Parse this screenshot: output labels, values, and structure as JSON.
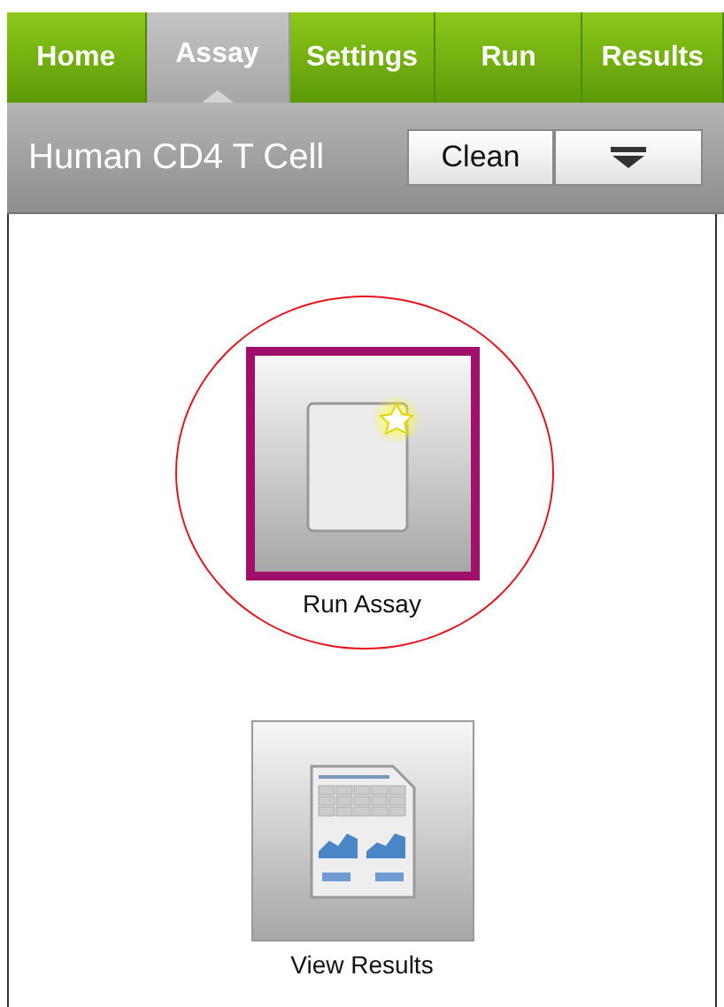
{
  "tabs": [
    {
      "label": "Home",
      "selected": false
    },
    {
      "label": "Assay",
      "selected": true
    },
    {
      "label": "Settings",
      "selected": false
    },
    {
      "label": "Run",
      "selected": false
    },
    {
      "label": "Results",
      "selected": false
    }
  ],
  "header": {
    "title": "Human CD4 T Cell",
    "buttons": [
      {
        "kind": "text",
        "label": "Clean"
      },
      {
        "kind": "menu"
      }
    ]
  },
  "tiles": [
    {
      "kind": "new-document",
      "label": "Run Assay",
      "selected": true,
      "circled": true
    },
    {
      "kind": "report",
      "label": "View Results",
      "selected": false,
      "circled": false
    }
  ]
}
